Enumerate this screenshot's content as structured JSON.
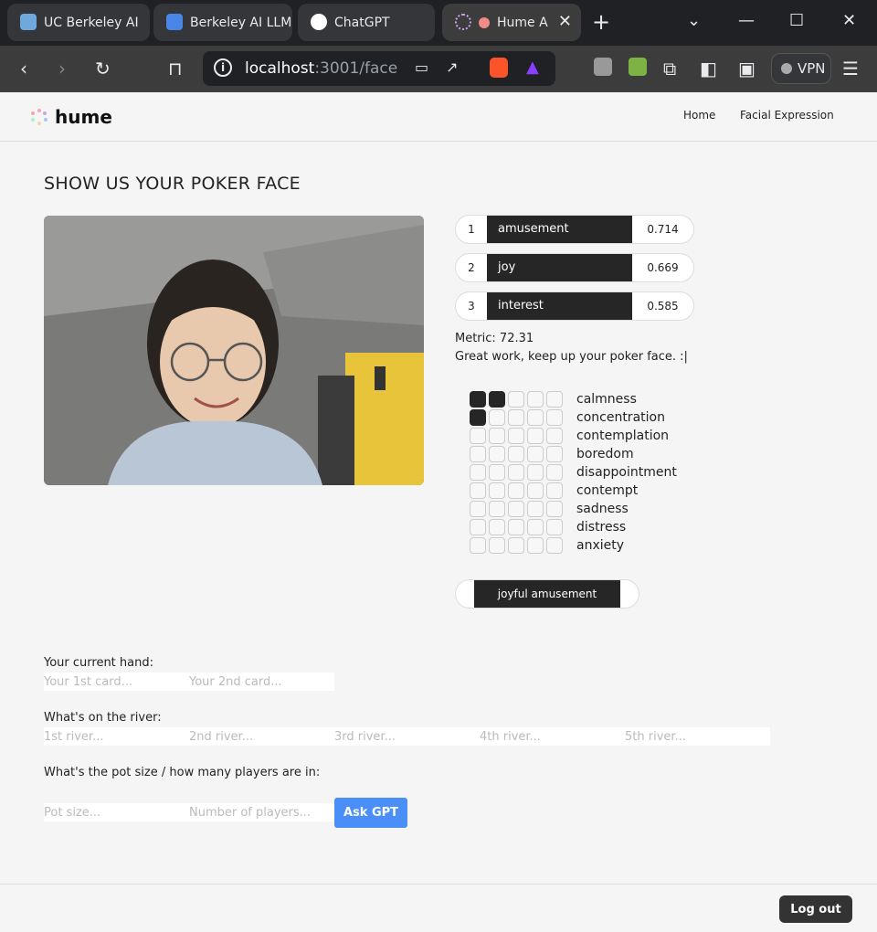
{
  "browser": {
    "tabs": [
      {
        "label": "UC Berkeley AI"
      },
      {
        "label": "Berkeley AI LLM"
      },
      {
        "label": "ChatGPT"
      },
      {
        "label": "Hume A"
      }
    ],
    "url_host": "localhost",
    "url_path": ":3001/face",
    "vpn_label": "VPN"
  },
  "app": {
    "logo_text": "hume",
    "nav": [
      "Home",
      "Facial Expression"
    ]
  },
  "main": {
    "title": "SHOW US YOUR POKER FACE",
    "top_emotions": [
      {
        "rank": "1",
        "emotion": "amusement",
        "score": "0.714"
      },
      {
        "rank": "2",
        "emotion": "joy",
        "score": "0.669"
      },
      {
        "rank": "3",
        "emotion": "interest",
        "score": "0.585"
      }
    ],
    "metric": "Metric: 72.31",
    "message": "Great work, keep up your poker face. :|",
    "emotion_grid": [
      {
        "label": "calmness",
        "level": 2
      },
      {
        "label": "concentration",
        "level": 1
      },
      {
        "label": "contemplation",
        "level": 0
      },
      {
        "label": "boredom",
        "level": 0
      },
      {
        "label": "disappointment",
        "level": 0
      },
      {
        "label": "contempt",
        "level": 0
      },
      {
        "label": "sadness",
        "level": 0
      },
      {
        "label": "distress",
        "level": 0
      },
      {
        "label": "anxiety",
        "level": 0
      }
    ],
    "summary": "joyful amusement"
  },
  "form": {
    "hand_label": "Your current hand:",
    "card1_placeholder": "Your 1st card...",
    "card2_placeholder": "Your 2nd card...",
    "river_label": "What's on the river:",
    "river_placeholders": [
      "1st river...",
      "2nd river...",
      "3rd river...",
      "4th river...",
      "5th river..."
    ],
    "pot_label": "What's the pot size / how many players are in:",
    "pot_placeholder": "Pot size...",
    "players_placeholder": "Number of players...",
    "ask_label": "Ask GPT"
  },
  "footer": {
    "logout_label": "Log out"
  },
  "colors": {
    "accent": "#4a8ef7",
    "dark": "#262626"
  }
}
